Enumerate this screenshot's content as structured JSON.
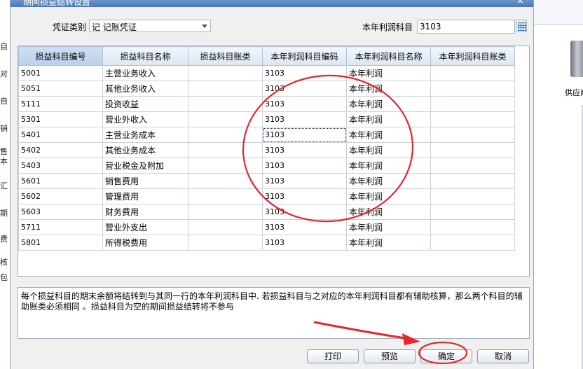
{
  "dialog": {
    "title": "期间损益结转设置",
    "close_glyph": "×"
  },
  "form": {
    "voucher_type_label": "凭证类别",
    "voucher_type_value": "记 记账凭证",
    "profit_account_label": "本年利润科目",
    "profit_account_value": "3103"
  },
  "table": {
    "headers": [
      "损益科目编号",
      "损益科目名称",
      "损益科目账类",
      "本年利润科目编码",
      "本年利润科目名称",
      "本年利润科目账类"
    ],
    "rows": [
      [
        "5001",
        "主营业务收入",
        "",
        "3103",
        "本年利润",
        ""
      ],
      [
        "5051",
        "其他业务收入",
        "",
        "3103",
        "本年利润",
        ""
      ],
      [
        "5111",
        "投资收益",
        "",
        "3103",
        "本年利润",
        ""
      ],
      [
        "5301",
        "营业外收入",
        "",
        "3103",
        "本年利润",
        ""
      ],
      [
        "5401",
        "主营业务成本",
        "",
        "3103",
        "本年利润",
        ""
      ],
      [
        "5402",
        "其他业务成本",
        "",
        "3103",
        "本年利润",
        ""
      ],
      [
        "5403",
        "营业税金及附加",
        "",
        "3103",
        "本年利润",
        ""
      ],
      [
        "5601",
        "销售费用",
        "",
        "3103",
        "本年利润",
        ""
      ],
      [
        "5602",
        "管理费用",
        "",
        "3103",
        "本年利润",
        ""
      ],
      [
        "5603",
        "财务费用",
        "",
        "3103",
        "本年利润",
        ""
      ],
      [
        "5711",
        "营业外支出",
        "",
        "3103",
        "本年利润",
        ""
      ],
      [
        "5801",
        "所得税费用",
        "",
        "3103",
        "本年利润",
        ""
      ]
    ]
  },
  "message": "每个损益科目的期末余额将结转到与其同一行的本年利润科目中. 若损益科目与之对应的本年利润科目都有辅助核算，那么两个科目的辅助账类必须相同 。损益科目为空的期间损益结转将不参与",
  "buttons": {
    "print": "打印",
    "preview": "预览",
    "ok": "确定",
    "cancel": "取消"
  },
  "background": {
    "left_fragments": [
      "自",
      "对",
      "自",
      "销",
      "售",
      "本",
      "汇",
      "期",
      "费",
      "核",
      "包"
    ],
    "right_label": "供应商"
  },
  "colors": {
    "annotation_red": "#e8252a",
    "header_bg": "#dce6f2",
    "titlebar": "#4a78b4"
  }
}
